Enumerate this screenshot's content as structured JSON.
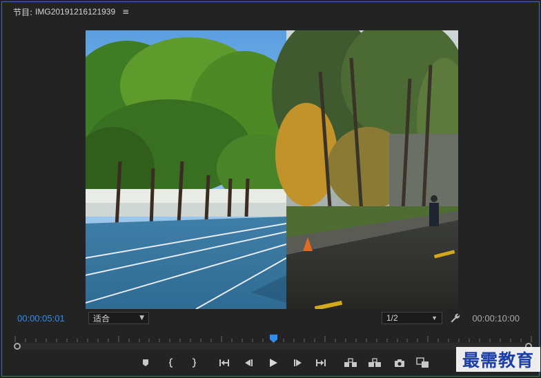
{
  "panel": {
    "title_prefix": "节目:",
    "title": "IMG20191216121939",
    "menu_glyph": "≡"
  },
  "timecode": {
    "current": "00:00:05:01",
    "total": "00:00:10:00"
  },
  "fit": {
    "value": "适合"
  },
  "quality": {
    "value": "1/2"
  },
  "playhead_fraction": 0.5,
  "watermark": {
    "text": "最需教育"
  },
  "colors": {
    "accent": "#2e8df0",
    "border": "#3f6fb8",
    "background": "#232323"
  },
  "icons": [
    "add-marker-icon",
    "mark-in-icon",
    "mark-out-icon",
    "go-to-in-icon",
    "step-back-icon",
    "play-icon",
    "step-forward-icon",
    "go-to-out-icon",
    "lift-icon",
    "extract-icon",
    "export-frame-icon",
    "comparison-view-icon",
    "settings-wrench-icon"
  ]
}
